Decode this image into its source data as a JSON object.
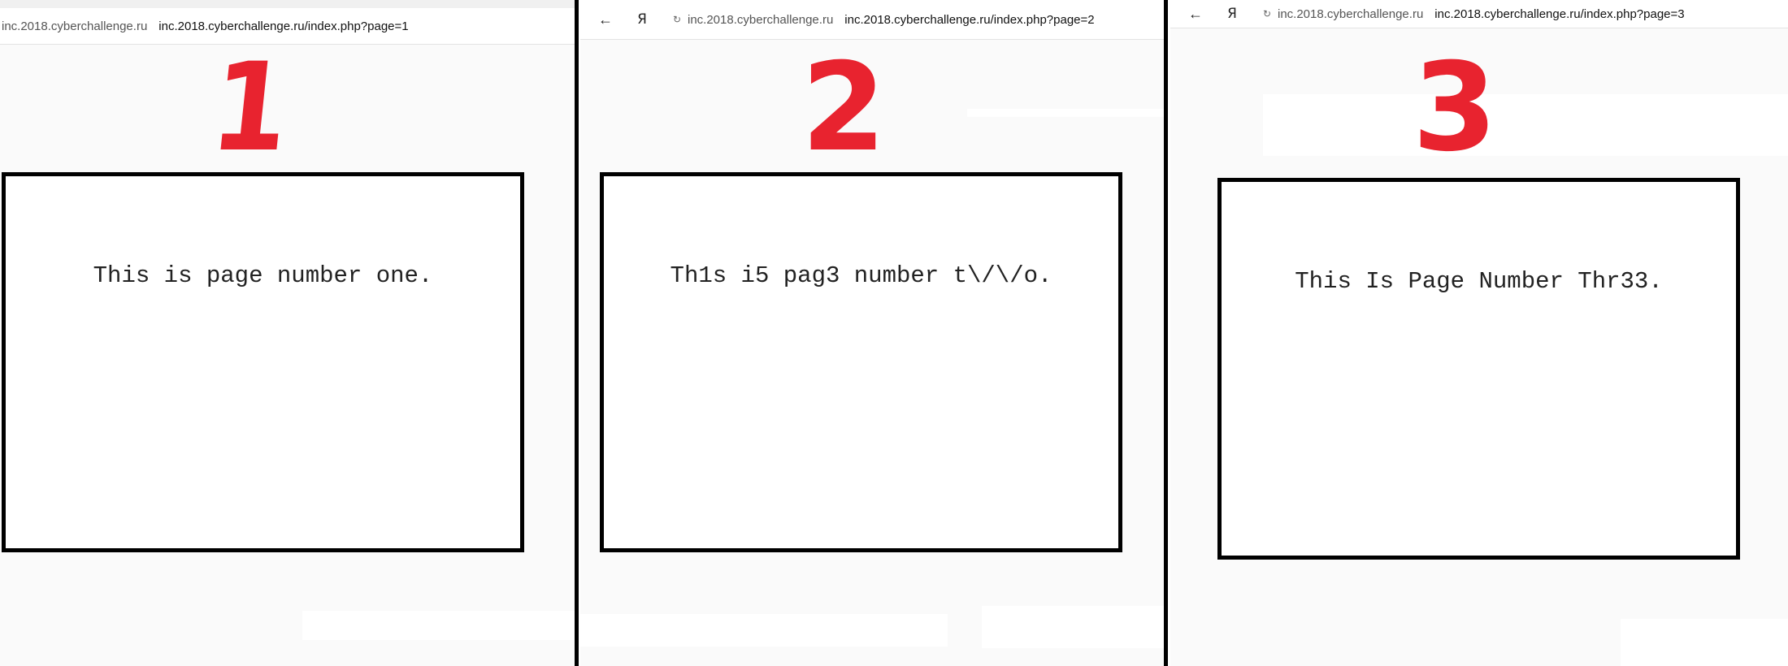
{
  "panels": [
    {
      "host": "inc.2018.cyberchallenge.ru",
      "url": "inc.2018.cyberchallenge.ru/index.php?page=1",
      "big_number": "1",
      "page_text": "This is page number one."
    },
    {
      "back_icon": "←",
      "ya_label": "Я",
      "reload_icon": "↻",
      "host": "inc.2018.cyberchallenge.ru",
      "url": "inc.2018.cyberchallenge.ru/index.php?page=2",
      "big_number": "2",
      "page_text": "Th1s i5 pag3 number t\\/\\/o."
    },
    {
      "back_icon": "←",
      "ya_label": "Я",
      "reload_icon": "↻",
      "host": "inc.2018.cyberchallenge.ru",
      "url": "inc.2018.cyberchallenge.ru/index.php?page=3",
      "big_number": "3",
      "page_text": "This Is Page Number Thr33."
    }
  ],
  "colors": {
    "number_red": "#e8232f",
    "box_border": "#000000",
    "panel_bg": "#fafafa"
  }
}
